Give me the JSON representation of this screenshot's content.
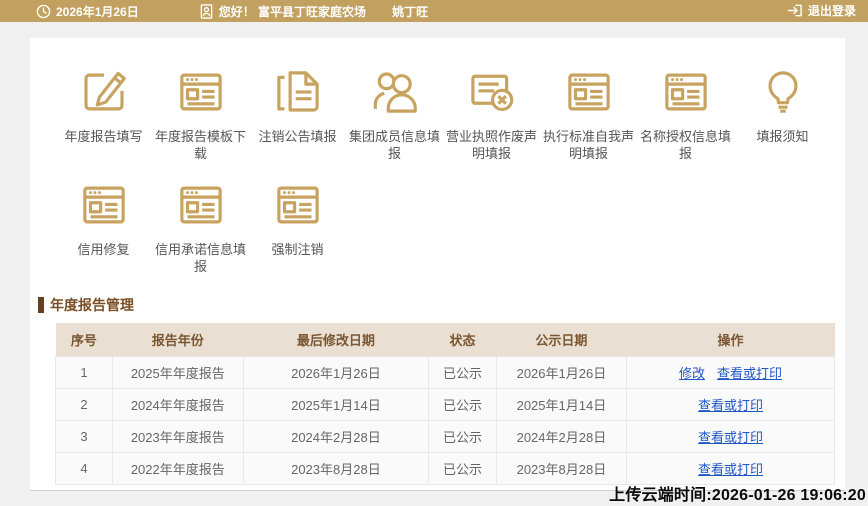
{
  "topbar": {
    "date": "2026年1月26日",
    "greeting": "您好！ 富平县丁旺家庭农场",
    "username": "姚丁旺",
    "logout_label": "退出登录",
    "bar_color": "#C2A160"
  },
  "grid": {
    "accent_color": "#C8A25F",
    "row1": [
      {
        "label": "年度报告填写",
        "icon": "edit-icon"
      },
      {
        "label": "年度报告模板下载",
        "icon": "webpage-form-icon"
      },
      {
        "label": "注销公告填报",
        "icon": "folded-document-icon"
      },
      {
        "label": "集团成员信息填报",
        "icon": "group-members-icon"
      },
      {
        "label": "营业执照作废声明填报",
        "icon": "license-void-icon"
      },
      {
        "label": "执行标准自我声明填报",
        "icon": "webpage-form-icon"
      },
      {
        "label": "名称授权信息填报",
        "icon": "webpage-form-icon"
      },
      {
        "label": "填报须知",
        "icon": "lightbulb-icon"
      }
    ],
    "row2": [
      {
        "label": "信用修复",
        "icon": "webpage-form-icon"
      },
      {
        "label": "信用承诺信息填报",
        "icon": "webpage-form-icon"
      },
      {
        "label": "强制注销",
        "icon": "webpage-form-icon"
      }
    ]
  },
  "main": {
    "section_title": "年度报告管理",
    "table": {
      "headers": [
        "序号",
        "报告年份",
        "最后修改日期",
        "状态",
        "公示日期",
        "操作"
      ],
      "link_color": "#2156C6",
      "rows": [
        {
          "no": "1",
          "year": "2025年年度报告",
          "modified": "2026年1月26日",
          "status": "已公示",
          "published": "2026年1月26日",
          "actions": [
            "修改",
            "查看或打印"
          ]
        },
        {
          "no": "2",
          "year": "2024年年度报告",
          "modified": "2025年1月14日",
          "status": "已公示",
          "published": "2025年1月14日",
          "actions": [
            "查看或打印"
          ]
        },
        {
          "no": "3",
          "year": "2023年年度报告",
          "modified": "2024年2月28日",
          "status": "已公示",
          "published": "2024年2月28日",
          "actions": [
            "查看或打印"
          ]
        },
        {
          "no": "4",
          "year": "2022年年度报告",
          "modified": "2023年8月28日",
          "status": "已公示",
          "published": "2023年8月28日",
          "actions": [
            "查看或打印"
          ]
        }
      ]
    }
  },
  "footer": {
    "upload_time": "上传云端时间:2026-01-26 19:06:20"
  }
}
